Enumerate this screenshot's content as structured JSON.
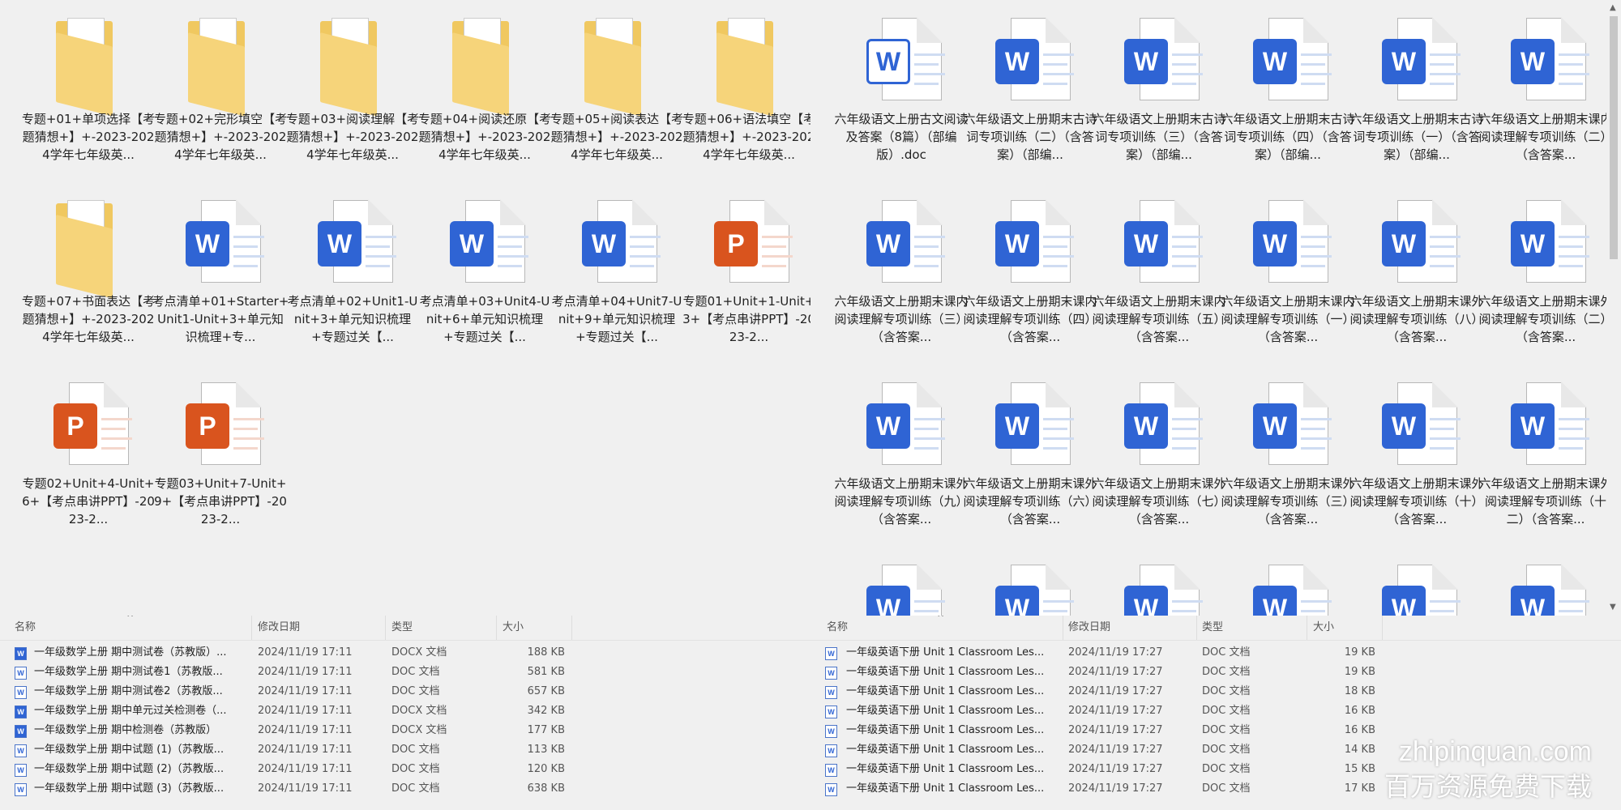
{
  "left_icons": [
    {
      "kind": "folder",
      "label": "专题+01+单项选择【考题猜想+】+-2023-2024学年七年级英..."
    },
    {
      "kind": "folder",
      "label": "专题+02+完形填空【考题猜想+】+-2023-2024学年七年级英..."
    },
    {
      "kind": "folder",
      "label": "专题+03+阅读理解【考题猜想+】+-2023-2024学年七年级英..."
    },
    {
      "kind": "folder",
      "label": "专题+04+阅读还原【考题猜想+】+-2023-2024学年七年级英..."
    },
    {
      "kind": "folder",
      "label": "专题+05+阅读表达【考题猜想+】+-2023-2024学年七年级英..."
    },
    {
      "kind": "folder",
      "label": "专题+06+语法填空【考题猜想+】+-2023-2024学年七年级英..."
    },
    {
      "kind": "folder",
      "label": "专题+07+书面表达【考题猜想+】+-2023-2024学年七年级英..."
    },
    {
      "kind": "word",
      "label": "考点清单+01+Starter+Unit1-Unit+3+单元知识梳理+专..."
    },
    {
      "kind": "word",
      "label": "考点清单+02+Unit1-Unit+3+单元知识梳理+专题过关【..."
    },
    {
      "kind": "word",
      "label": "考点清单+03+Unit4-Unit+6+单元知识梳理+专题过关【..."
    },
    {
      "kind": "word",
      "label": "考点清单+04+Unit7-Unit+9+单元知识梳理+专题过关【..."
    },
    {
      "kind": "ppt",
      "label": "专题01+Unit+1-Unit+3+【考点串讲PPT】-2023-2..."
    },
    {
      "kind": "ppt",
      "label": "专题02+Unit+4-Unit+6+【考点串讲PPT】-2023-2..."
    },
    {
      "kind": "ppt",
      "label": "专题03+Unit+7-Unit+9+【考点串讲PPT】-2023-2..."
    }
  ],
  "right_icons": [
    {
      "kind": "word-pale",
      "label": "六年级语文上册古文阅读及答案（8篇）（部编版）.doc"
    },
    {
      "kind": "word",
      "label": "六年级语文上册期末古诗词专项训练（二）（含答案）（部编..."
    },
    {
      "kind": "word",
      "label": "六年级语文上册期末古诗词专项训练（三）（含答案）（部编..."
    },
    {
      "kind": "word",
      "label": "六年级语文上册期末古诗词专项训练（四）（含答案）（部编..."
    },
    {
      "kind": "word",
      "label": "六年级语文上册期末古诗词专项训练（一）（含答案）（部编..."
    },
    {
      "kind": "word",
      "label": "六年级语文上册期末课内阅读理解专项训练（二）（含答案..."
    },
    {
      "kind": "word",
      "label": "六年级语文上册期末课内阅读理解专项训练（三）（含答案..."
    },
    {
      "kind": "word",
      "label": "六年级语文上册期末课内阅读理解专项训练（四）（含答案..."
    },
    {
      "kind": "word",
      "label": "六年级语文上册期末课内阅读理解专项训练（五）（含答案..."
    },
    {
      "kind": "word",
      "label": "六年级语文上册期末课内阅读理解专项训练（一）（含答案..."
    },
    {
      "kind": "word",
      "label": "六年级语文上册期末课外阅读理解专项训练（八）（含答案..."
    },
    {
      "kind": "word",
      "label": "六年级语文上册期末课外阅读理解专项训练（二）（含答案..."
    },
    {
      "kind": "word",
      "label": "六年级语文上册期末课外阅读理解专项训练（九）（含答案..."
    },
    {
      "kind": "word",
      "label": "六年级语文上册期末课外阅读理解专项训练（六）（含答案..."
    },
    {
      "kind": "word",
      "label": "六年级语文上册期末课外阅读理解专项训练（七）（含答案..."
    },
    {
      "kind": "word",
      "label": "六年级语文上册期末课外阅读理解专项训练（三）（含答案..."
    },
    {
      "kind": "word",
      "label": "六年级语文上册期末课外阅读理解专项训练（十）（含答案..."
    },
    {
      "kind": "word",
      "label": "六年级语文上册期末课外阅读理解专项训练（十二）（含答案..."
    },
    {
      "kind": "word",
      "label": ""
    },
    {
      "kind": "word",
      "label": ""
    },
    {
      "kind": "word",
      "label": ""
    },
    {
      "kind": "word",
      "label": ""
    },
    {
      "kind": "word",
      "label": ""
    },
    {
      "kind": "word",
      "label": ""
    }
  ],
  "tile_letters": {
    "word": "W",
    "ppt": "P"
  },
  "left_list": {
    "columns": {
      "name": "名称",
      "modified": "修改日期",
      "type": "类型",
      "size": "大小"
    },
    "rows": [
      {
        "icon": "docx",
        "name": "一年级数学上册  期中测试卷（苏教版）...",
        "modified": "2024/11/19 17:11",
        "type": "DOCX 文档",
        "size": "188 KB"
      },
      {
        "icon": "doc",
        "name": "一年级数学上册  期中测试卷1（苏教版...",
        "modified": "2024/11/19 17:11",
        "type": "DOC 文档",
        "size": "581 KB"
      },
      {
        "icon": "doc",
        "name": "一年级数学上册  期中测试卷2（苏教版...",
        "modified": "2024/11/19 17:11",
        "type": "DOC 文档",
        "size": "657 KB"
      },
      {
        "icon": "docx",
        "name": "一年级数学上册  期中单元过关检测卷（...",
        "modified": "2024/11/19 17:11",
        "type": "DOCX 文档",
        "size": "342 KB"
      },
      {
        "icon": "docx",
        "name": "一年级数学上册  期中检测卷（苏教版）",
        "modified": "2024/11/19 17:11",
        "type": "DOCX 文档",
        "size": "177 KB"
      },
      {
        "icon": "doc",
        "name": "一年级数学上册  期中试题 (1)（苏教版...",
        "modified": "2024/11/19 17:11",
        "type": "DOC 文档",
        "size": "113 KB"
      },
      {
        "icon": "doc",
        "name": "一年级数学上册  期中试题 (2)（苏教版...",
        "modified": "2024/11/19 17:11",
        "type": "DOC 文档",
        "size": "120 KB"
      },
      {
        "icon": "doc",
        "name": "一年级数学上册  期中试题 (3)（苏教版...",
        "modified": "2024/11/19 17:11",
        "type": "DOC 文档",
        "size": "638 KB"
      }
    ]
  },
  "right_list": {
    "columns": {
      "name": "名称",
      "modified": "修改日期",
      "type": "类型",
      "size": "大小"
    },
    "rows": [
      {
        "icon": "doc",
        "name": "一年级英语下册  Unit 1 Classroom Les...",
        "modified": "2024/11/19 17:27",
        "type": "DOC 文档",
        "size": "19 KB"
      },
      {
        "icon": "doc",
        "name": "一年级英语下册  Unit 1 Classroom Les...",
        "modified": "2024/11/19 17:27",
        "type": "DOC 文档",
        "size": "19 KB"
      },
      {
        "icon": "doc",
        "name": "一年级英语下册  Unit 1 Classroom Les...",
        "modified": "2024/11/19 17:27",
        "type": "DOC 文档",
        "size": "18 KB"
      },
      {
        "icon": "doc",
        "name": "一年级英语下册  Unit 1 Classroom Les...",
        "modified": "2024/11/19 17:27",
        "type": "DOC 文档",
        "size": "16 KB"
      },
      {
        "icon": "doc",
        "name": "一年级英语下册  Unit 1 Classroom Les...",
        "modified": "2024/11/19 17:27",
        "type": "DOC 文档",
        "size": "16 KB"
      },
      {
        "icon": "doc",
        "name": "一年级英语下册  Unit 1 Classroom Les...",
        "modified": "2024/11/19 17:27",
        "type": "DOC 文档",
        "size": "14 KB"
      },
      {
        "icon": "doc",
        "name": "一年级英语下册  Unit 1 Classroom Les...",
        "modified": "2024/11/19 17:27",
        "type": "DOC 文档",
        "size": "15 KB"
      },
      {
        "icon": "doc",
        "name": "一年级英语下册  Unit 1 Classroom Les...",
        "modified": "2024/11/19 17:27",
        "type": "DOC 文档",
        "size": "17 KB"
      }
    ]
  },
  "sort_caret": "^",
  "scroll_arrows": {
    "up": "▲",
    "down": "▼"
  },
  "watermark": {
    "line1": "zhipinquan.com",
    "line2": "百万资源免费下载"
  },
  "colors": {
    "word_blue": "#2f64d4",
    "ppt_orange": "#d9541e",
    "folder": "#f0c860"
  }
}
